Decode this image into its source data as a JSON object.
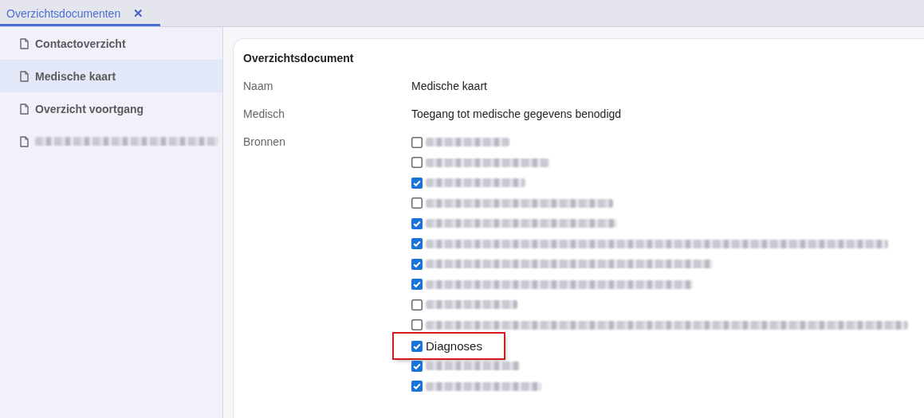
{
  "tabs": [
    {
      "label": "Overzichtsdocumenten",
      "selected": true,
      "close_icon": "✕"
    }
  ],
  "sidebar": {
    "items": [
      {
        "kind": "text",
        "label": "Contactoverzicht",
        "selected": false
      },
      {
        "kind": "text",
        "label": "Medische kaart",
        "selected": true
      },
      {
        "kind": "text",
        "label": "Overzicht voortgang",
        "selected": false
      },
      {
        "kind": "redacted",
        "selected": false
      }
    ]
  },
  "card": {
    "title": "Overzichtsdocument",
    "fields": [
      {
        "label": "Naam",
        "value": "Medische kaart"
      },
      {
        "label": "Medisch",
        "value": "Toegang tot medische gegevens benodigd"
      }
    ],
    "sources_label": "Bronnen",
    "sources": [
      {
        "kind": "redacted",
        "checked": false,
        "highlighted": false
      },
      {
        "kind": "redacted",
        "checked": false,
        "highlighted": false
      },
      {
        "kind": "redacted",
        "checked": true,
        "highlighted": false
      },
      {
        "kind": "redacted",
        "checked": false,
        "highlighted": false
      },
      {
        "kind": "redacted",
        "checked": true,
        "highlighted": false
      },
      {
        "kind": "redacted",
        "checked": true,
        "highlighted": false
      },
      {
        "kind": "redacted",
        "checked": true,
        "highlighted": false
      },
      {
        "kind": "redacted",
        "checked": true,
        "highlighted": false
      },
      {
        "kind": "redacted",
        "checked": false,
        "highlighted": false
      },
      {
        "kind": "redacted",
        "checked": false,
        "highlighted": false
      },
      {
        "kind": "text",
        "label": "Diagnoses",
        "checked": true,
        "highlighted": true
      },
      {
        "kind": "redacted",
        "checked": true,
        "highlighted": false
      },
      {
        "kind": "redacted",
        "checked": true,
        "highlighted": false
      }
    ]
  }
}
